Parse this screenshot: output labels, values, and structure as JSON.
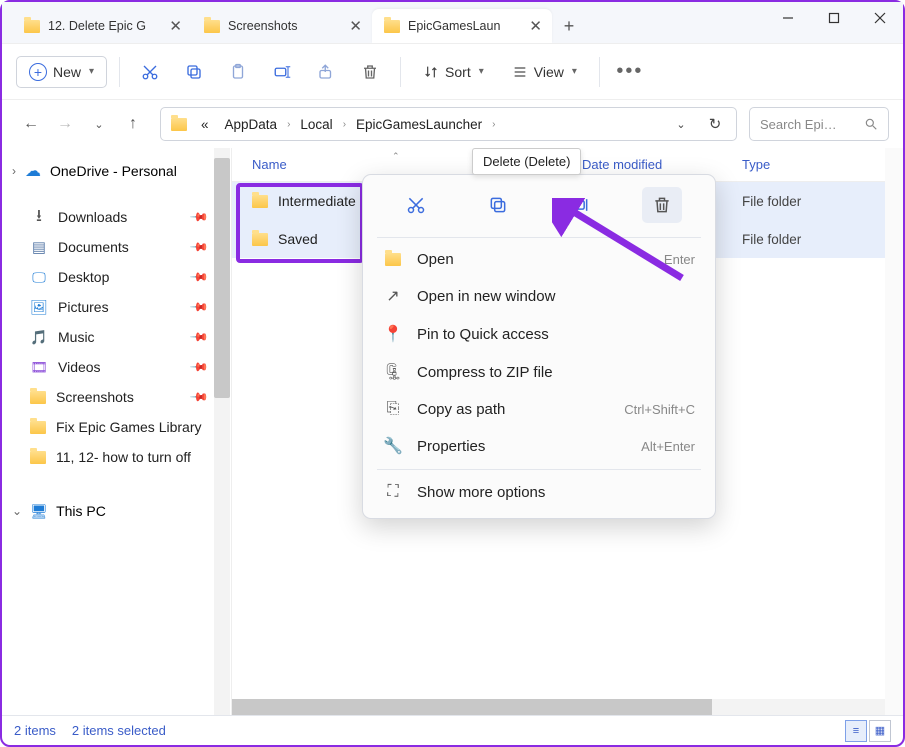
{
  "window": {
    "min": "—",
    "max": "□",
    "close": "✕"
  },
  "tabs": [
    {
      "label": "12. Delete Epic G"
    },
    {
      "label": "Screenshots"
    },
    {
      "label": "EpicGamesLaun"
    }
  ],
  "newtab": "+",
  "toolbar": {
    "new_label": "New",
    "sort_label": "Sort",
    "view_label": "View"
  },
  "addr": {
    "crumbs": [
      "AppData",
      "Local",
      "EpicGamesLauncher"
    ],
    "prefix": "«"
  },
  "search": {
    "placeholder": "Search Epi…"
  },
  "sidebar": {
    "onedrive": "OneDrive - Personal",
    "items": [
      {
        "label": "Downloads"
      },
      {
        "label": "Documents"
      },
      {
        "label": "Desktop"
      },
      {
        "label": "Pictures"
      },
      {
        "label": "Music"
      },
      {
        "label": "Videos"
      },
      {
        "label": "Screenshots"
      },
      {
        "label": "Fix Epic Games Library"
      },
      {
        "label": "11, 12- how to turn off"
      }
    ],
    "thispc": "This PC"
  },
  "columns": {
    "name": "Name",
    "date": "Date modified",
    "type": "Type"
  },
  "rows": [
    {
      "name": "Intermediate",
      "type": "File folder"
    },
    {
      "name": "Saved",
      "type": "File folder"
    }
  ],
  "tooltip": "Delete (Delete)",
  "context": {
    "open": "Open",
    "open_sc": "Enter",
    "opennew": "Open in new window",
    "pin": "Pin to Quick access",
    "zip": "Compress to ZIP file",
    "copypath": "Copy as path",
    "copypath_sc": "Ctrl+Shift+C",
    "props": "Properties",
    "props_sc": "Alt+Enter",
    "more": "Show more options"
  },
  "status": {
    "count": "2 items",
    "selected": "2 items selected"
  }
}
